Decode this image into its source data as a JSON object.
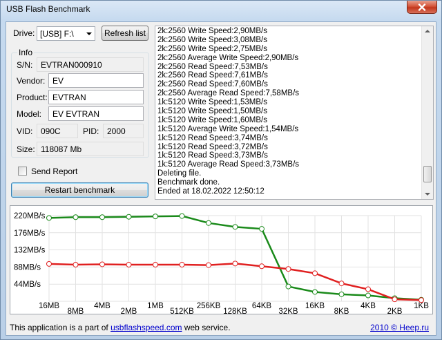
{
  "window": {
    "title": "USB Flash Benchmark"
  },
  "drive": {
    "label": "Drive:",
    "selected": "[USB] F:\\"
  },
  "buttons": {
    "refresh": "Refresh list",
    "restart": "Restart benchmark"
  },
  "info": {
    "title": "Info",
    "serial_label": "S/N:",
    "serial": "EVTRAN000910",
    "vendor_label": "Vendor:",
    "vendor": "EV",
    "product_label": "Product:",
    "product": "EVTRAN",
    "model_label": "Model:",
    "model": "EV EVTRAN",
    "vid_label": "VID:",
    "vid": "090C",
    "pid_label": "PID:",
    "pid": "2000",
    "size_label": "Size:",
    "size": "118087 Mb"
  },
  "send_report": {
    "label": "Send Report",
    "checked": false
  },
  "log": [
    "2k:2560 Write Speed:2,90MB/s",
    "2k:2560 Write Speed:3,08MB/s",
    "2k:2560 Write Speed:2,75MB/s",
    "2k:2560 Average Write Speed:2,90MB/s",
    "2k:2560 Read Speed:7,53MB/s",
    "2k:2560 Read Speed:7,61MB/s",
    "2k:2560 Read Speed:7,60MB/s",
    "2k:2560 Average Read Speed:7,58MB/s",
    "1k:5120 Write Speed:1,53MB/s",
    "1k:5120 Write Speed:1,50MB/s",
    "1k:5120 Write Speed:1,60MB/s",
    "1k:5120 Average Write Speed:1,54MB/s",
    "1k:5120 Read Speed:3,74MB/s",
    "1k:5120 Read Speed:3,72MB/s",
    "1k:5120 Read Speed:3,73MB/s",
    "1k:5120 Average Read Speed:3,73MB/s",
    "Deleting file.",
    "Benchmark done.",
    "Ended at 18.02.2022 12:50:12"
  ],
  "chart_data": {
    "type": "line",
    "categories": [
      "16MB",
      "8MB",
      "4MB",
      "2MB",
      "1MB",
      "512KB",
      "256KB",
      "128KB",
      "64KB",
      "32KB",
      "16KB",
      "8KB",
      "4KB",
      "2KB",
      "1KB"
    ],
    "yticks": [
      "220MB/s",
      "176MB/s",
      "132MB/s",
      "88MB/s",
      "44MB/s"
    ],
    "ylim": [
      0,
      220
    ],
    "series": [
      {
        "color": "#1a8a1a",
        "values": [
          214,
          216,
          216,
          217,
          218,
          219,
          201,
          191,
          186,
          38,
          24,
          18,
          15,
          8,
          4
        ]
      },
      {
        "color": "#e02020",
        "values": [
          96,
          94,
          95,
          94,
          94,
          94,
          93,
          97,
          90,
          83,
          72,
          46,
          31,
          5,
          3
        ]
      }
    ],
    "grid": true
  },
  "footer": {
    "prefix": "This application is a part of",
    "link": "usbflashspeed.com",
    "suffix": "web service.",
    "copyright": "2010 © Heep.ru"
  }
}
